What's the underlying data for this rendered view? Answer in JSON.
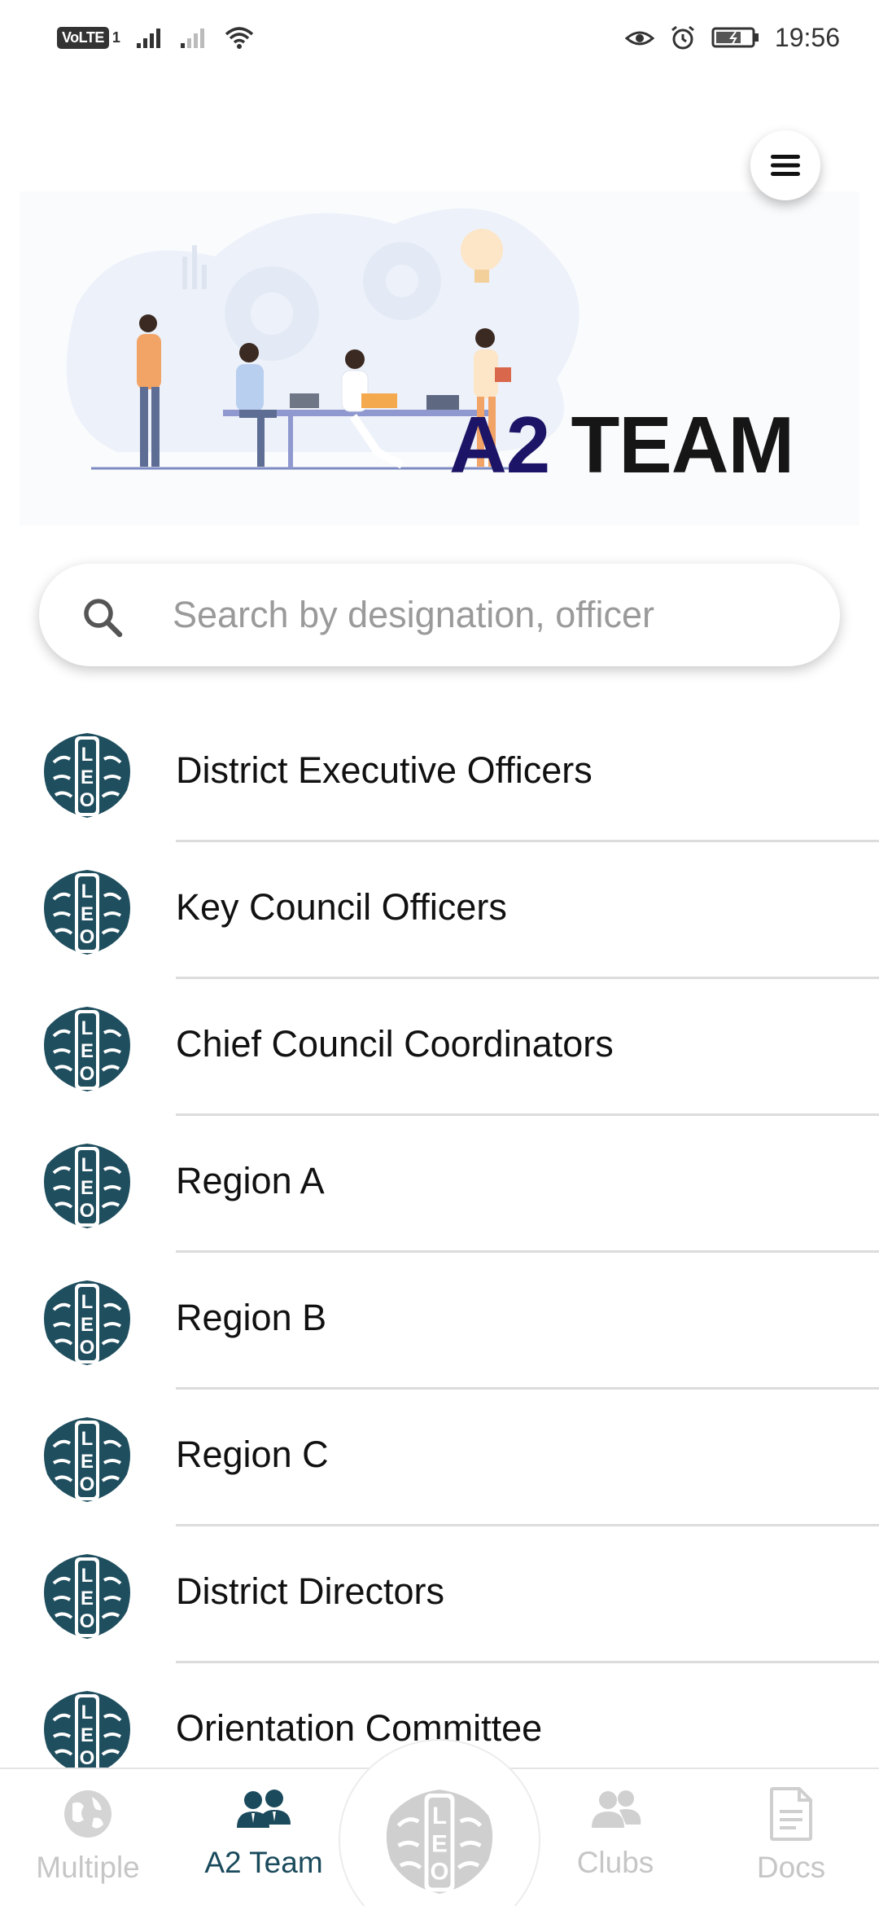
{
  "status_bar": {
    "volte_label": "VoLTE",
    "sim_slot": "1",
    "time": "19:56"
  },
  "hero": {
    "title_part1": "A2",
    "title_part2": "TEAM"
  },
  "search": {
    "placeholder": "Search by designation, officer",
    "value": ""
  },
  "list": {
    "items": [
      {
        "label": "District Executive Officers"
      },
      {
        "label": "Key Council Officers"
      },
      {
        "label": "Chief Council Coordinators"
      },
      {
        "label": "Region A"
      },
      {
        "label": "Region B"
      },
      {
        "label": "Region C"
      },
      {
        "label": "District Directors"
      },
      {
        "label": "Orientation Committee"
      }
    ]
  },
  "bottom_nav": {
    "items": [
      {
        "label": "Multiple",
        "icon": "globe-icon",
        "active": false
      },
      {
        "label": "A2 Team",
        "icon": "team-icon",
        "active": true
      },
      {
        "label": "Clubs",
        "icon": "clubs-icon",
        "active": false
      },
      {
        "label": "Docs",
        "icon": "docs-icon",
        "active": false
      }
    ]
  },
  "colors": {
    "accent": "#1a4a5c",
    "title_dark_blue": "#1c1466",
    "inactive_nav": "#c6c6c6",
    "logo_teal": "#1f4e5e"
  }
}
